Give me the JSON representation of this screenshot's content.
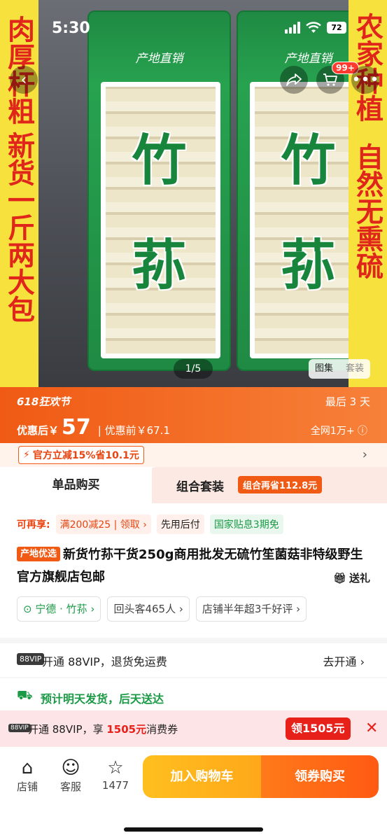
{
  "status": {
    "time": "5:30",
    "battery": "72"
  },
  "hero": {
    "left_banner": [
      "肉厚杆粗",
      "新货一斤两大包"
    ],
    "right_banner": [
      "农家种植",
      "自然无熏硫"
    ],
    "package_brand": "产地直销",
    "package_chars": [
      "竹",
      "荪"
    ],
    "cart_badge": "99+",
    "counter": "1/5",
    "tabs": [
      "图集",
      "套装"
    ]
  },
  "promo": {
    "title": "618狂欢节",
    "countdown": "最后 3 天",
    "after_label": "优惠后￥",
    "after_value": "57",
    "before": "| 优惠前￥67.1",
    "sales": "全网1万+",
    "coupon": "官方立减15%省10.1元"
  },
  "buy_tabs": {
    "single": "单品购买",
    "bundle": "组合套装",
    "bundle_chip": "组合再省112.8元"
  },
  "perks": {
    "lead": "可再享:",
    "items": [
      "满200减25 | 领取 ›",
      "先用后付",
      "国家贴息3期免"
    ]
  },
  "product": {
    "source_tag": "产地优选",
    "title": "新货竹荪干货250g商用批发无硫竹笙菌菇非特级野生官方旗舰店包邮",
    "gift": "送礼"
  },
  "tags": [
    "宁德 · 竹荪 ›",
    "回头客465人 ›",
    "店铺半年超3千好评 ›"
  ],
  "vip": {
    "logo": "88VIP",
    "text": "开通 88VIP，退货免运费",
    "link": "去开通 ›"
  },
  "delivery": {
    "text": "预计明天发货，后天送达"
  },
  "coupon_banner": {
    "logo": "88VIP",
    "prefix": "开通 88VIP，享 ",
    "amount": "1505元",
    "suffix": "消费券",
    "button": "领1505元"
  },
  "bottom": {
    "store": "店铺",
    "service": "客服",
    "fav_count": "1477",
    "add_cart": "加入购物车",
    "buy": "领券购买"
  }
}
